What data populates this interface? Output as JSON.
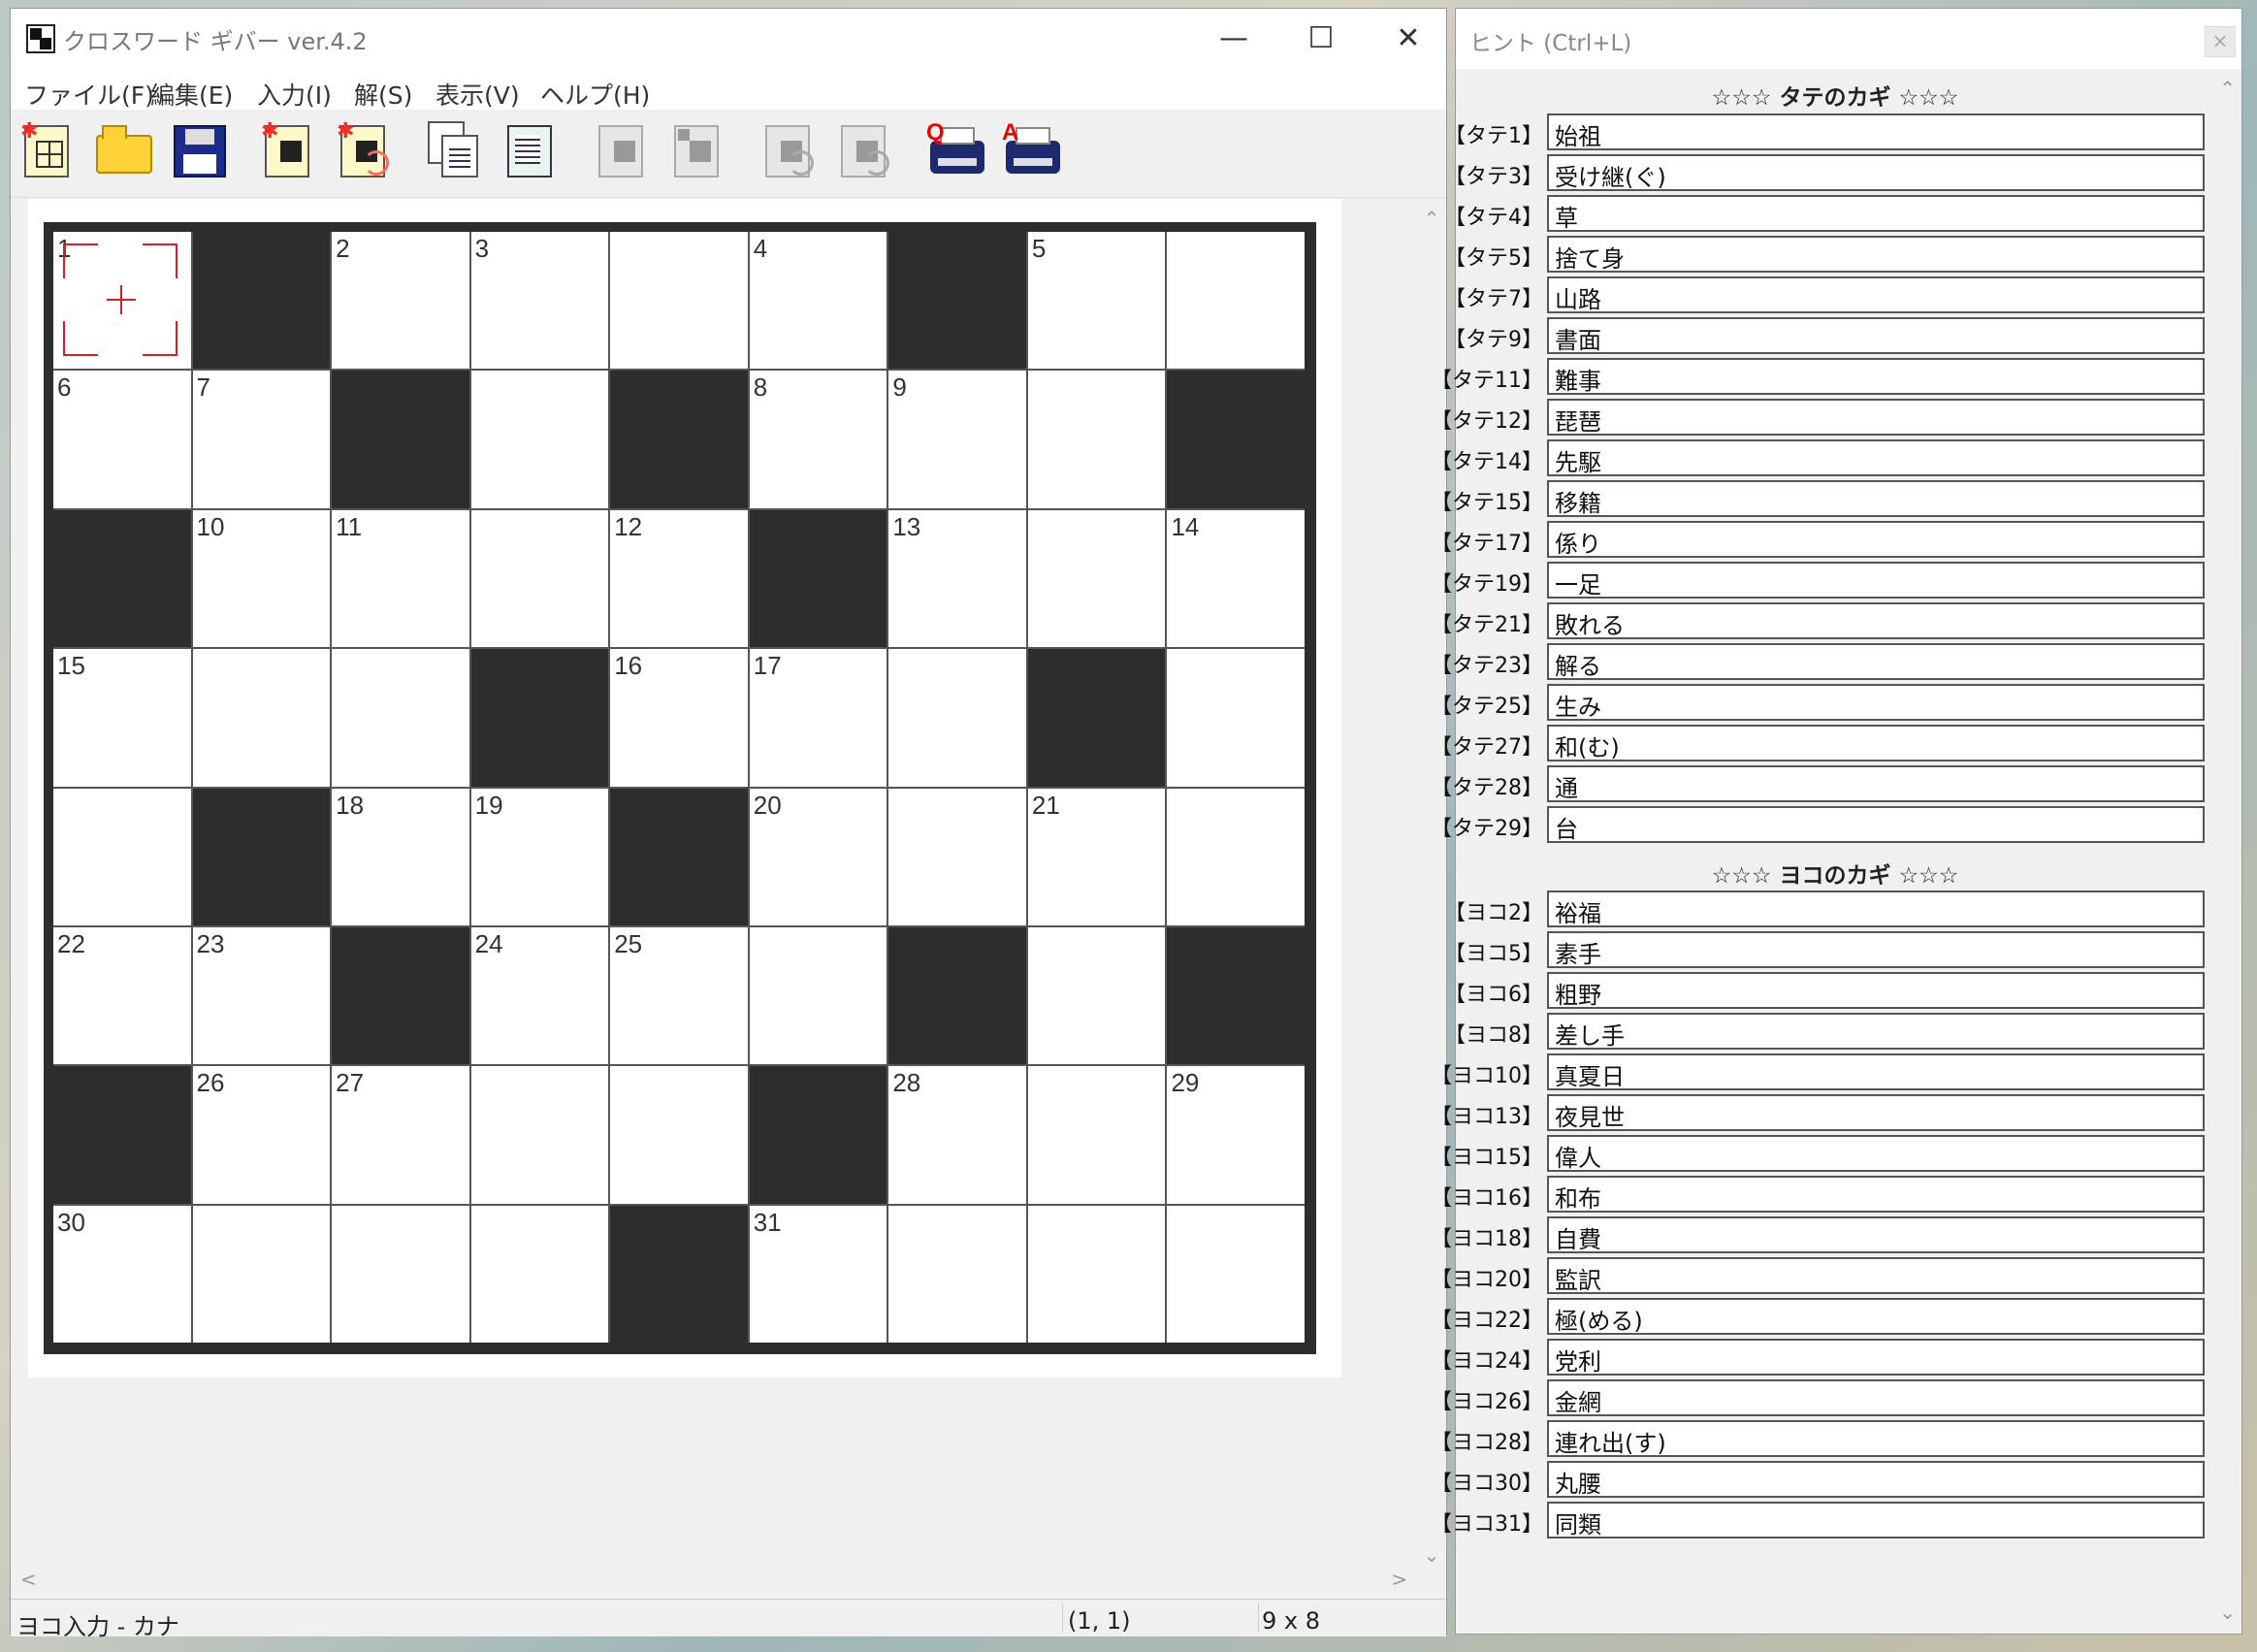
{
  "window": {
    "title": "クロスワード ギバー ver.4.2",
    "minimize": "—",
    "maximize": "☐",
    "close": "✕"
  },
  "menu": [
    "ファイル(F)",
    "編集(E)",
    "入力(I)",
    "解(S)",
    "表示(V)",
    "ヘルプ(H)"
  ],
  "toolbar": {
    "icons": [
      "new-grid-icon",
      "open-folder-icon",
      "save-disk-icon",
      "new-puzzle-icon",
      "rotate-puzzle-icon",
      "copy-icon",
      "paste-icon",
      "grid-export-icon",
      "grid-export-2-icon",
      "undo-icon",
      "redo-icon",
      "print-question-icon",
      "print-answer-icon"
    ],
    "print_q_letter": "Q",
    "print_a_letter": "A"
  },
  "grid": {
    "cols": 9,
    "rows": 8,
    "layout": [
      "#..#.#..",
      ".#.#...#",
      "#.......",
      "...#..#.",
      ".#..#.#.",
      "..#..#.#",
      "#......#",
      "....#...."
    ],
    "black": [
      [
        0,
        1
      ],
      [
        0,
        6
      ],
      [
        1,
        2
      ],
      [
        1,
        4
      ],
      [
        1,
        8
      ],
      [
        2,
        0
      ],
      [
        2,
        5
      ],
      [
        3,
        3
      ],
      [
        3,
        7
      ],
      [
        4,
        1
      ],
      [
        4,
        4
      ],
      [
        5,
        2
      ],
      [
        5,
        6
      ],
      [
        5,
        8
      ],
      [
        6,
        0
      ],
      [
        6,
        5
      ],
      [
        7,
        4
      ]
    ],
    "numbers": [
      {
        "r": 0,
        "c": 0,
        "n": "1"
      },
      {
        "r": 0,
        "c": 2,
        "n": "2"
      },
      {
        "r": 0,
        "c": 3,
        "n": "3"
      },
      {
        "r": 0,
        "c": 5,
        "n": "4"
      },
      {
        "r": 0,
        "c": 7,
        "n": "5"
      },
      {
        "r": 1,
        "c": 0,
        "n": "6"
      },
      {
        "r": 1,
        "c": 1,
        "n": "7"
      },
      {
        "r": 1,
        "c": 5,
        "n": "8"
      },
      {
        "r": 1,
        "c": 6,
        "n": "9"
      },
      {
        "r": 2,
        "c": 1,
        "n": "10"
      },
      {
        "r": 2,
        "c": 2,
        "n": "11"
      },
      {
        "r": 2,
        "c": 4,
        "n": "12"
      },
      {
        "r": 2,
        "c": 6,
        "n": "13"
      },
      {
        "r": 2,
        "c": 8,
        "n": "14"
      },
      {
        "r": 3,
        "c": 0,
        "n": "15"
      },
      {
        "r": 3,
        "c": 4,
        "n": "16"
      },
      {
        "r": 3,
        "c": 5,
        "n": "17"
      },
      {
        "r": 4,
        "c": 2,
        "n": "18"
      },
      {
        "r": 4,
        "c": 3,
        "n": "19"
      },
      {
        "r": 4,
        "c": 5,
        "n": "20"
      },
      {
        "r": 4,
        "c": 7,
        "n": "21"
      },
      {
        "r": 5,
        "c": 0,
        "n": "22"
      },
      {
        "r": 5,
        "c": 1,
        "n": "23"
      },
      {
        "r": 5,
        "c": 3,
        "n": "24"
      },
      {
        "r": 5,
        "c": 4,
        "n": "25"
      },
      {
        "r": 6,
        "c": 1,
        "n": "26"
      },
      {
        "r": 6,
        "c": 2,
        "n": "27"
      },
      {
        "r": 6,
        "c": 6,
        "n": "28"
      },
      {
        "r": 6,
        "c": 8,
        "n": "29"
      },
      {
        "r": 7,
        "c": 0,
        "n": "30"
      },
      {
        "r": 7,
        "c": 5,
        "n": "31"
      }
    ],
    "cursor": {
      "r": 0,
      "c": 0
    }
  },
  "status": {
    "mode": "ヨコ入力 - カナ",
    "position": "(1, 1)",
    "size": "9 x 8"
  },
  "scroll": {
    "up": "⌃",
    "down": "⌄",
    "left": "<",
    "right": ">"
  },
  "hints": {
    "title": "ヒント (Ctrl+L)",
    "close": "×",
    "down_title": "☆☆☆ タテのカギ ☆☆☆",
    "across_title": "☆☆☆ ヨコのカギ ☆☆☆",
    "down": [
      {
        "label": "【タテ1】",
        "value": "始祖"
      },
      {
        "label": "【タテ3】",
        "value": "受け継(ぐ)"
      },
      {
        "label": "【タテ4】",
        "value": "草"
      },
      {
        "label": "【タテ5】",
        "value": "捨て身"
      },
      {
        "label": "【タテ7】",
        "value": "山路"
      },
      {
        "label": "【タテ9】",
        "value": "書面"
      },
      {
        "label": "【タテ11】",
        "value": "難事"
      },
      {
        "label": "【タテ12】",
        "value": "琵琶"
      },
      {
        "label": "【タテ14】",
        "value": "先駆"
      },
      {
        "label": "【タテ15】",
        "value": "移籍"
      },
      {
        "label": "【タテ17】",
        "value": "係り"
      },
      {
        "label": "【タテ19】",
        "value": "一足"
      },
      {
        "label": "【タテ21】",
        "value": "敗れる"
      },
      {
        "label": "【タテ23】",
        "value": "解る"
      },
      {
        "label": "【タテ25】",
        "value": "生み"
      },
      {
        "label": "【タテ27】",
        "value": "和(む)"
      },
      {
        "label": "【タテ28】",
        "value": "通"
      },
      {
        "label": "【タテ29】",
        "value": "台"
      }
    ],
    "across": [
      {
        "label": "【ヨコ2】",
        "value": "裕福"
      },
      {
        "label": "【ヨコ5】",
        "value": "素手"
      },
      {
        "label": "【ヨコ6】",
        "value": "粗野"
      },
      {
        "label": "【ヨコ8】",
        "value": "差し手"
      },
      {
        "label": "【ヨコ10】",
        "value": "真夏日"
      },
      {
        "label": "【ヨコ13】",
        "value": "夜見世"
      },
      {
        "label": "【ヨコ15】",
        "value": "偉人"
      },
      {
        "label": "【ヨコ16】",
        "value": "和布"
      },
      {
        "label": "【ヨコ18】",
        "value": "自費"
      },
      {
        "label": "【ヨコ20】",
        "value": "監訳"
      },
      {
        "label": "【ヨコ22】",
        "value": "極(める)"
      },
      {
        "label": "【ヨコ24】",
        "value": "党利"
      },
      {
        "label": "【ヨコ26】",
        "value": "金網"
      },
      {
        "label": "【ヨコ28】",
        "value": "連れ出(す)"
      },
      {
        "label": "【ヨコ30】",
        "value": "丸腰"
      },
      {
        "label": "【ヨコ31】",
        "value": "同類"
      }
    ]
  }
}
